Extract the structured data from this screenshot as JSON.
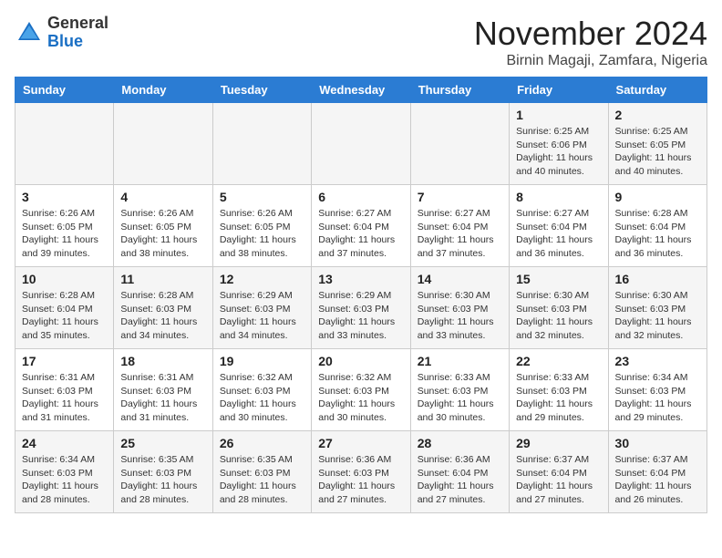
{
  "header": {
    "logo_line1": "General",
    "logo_line2": "Blue",
    "month_title": "November 2024",
    "subtitle": "Birnin Magaji, Zamfara, Nigeria"
  },
  "days_of_week": [
    "Sunday",
    "Monday",
    "Tuesday",
    "Wednesday",
    "Thursday",
    "Friday",
    "Saturday"
  ],
  "weeks": [
    [
      {
        "day": "",
        "info": ""
      },
      {
        "day": "",
        "info": ""
      },
      {
        "day": "",
        "info": ""
      },
      {
        "day": "",
        "info": ""
      },
      {
        "day": "",
        "info": ""
      },
      {
        "day": "1",
        "info": "Sunrise: 6:25 AM\nSunset: 6:06 PM\nDaylight: 11 hours and 40 minutes."
      },
      {
        "day": "2",
        "info": "Sunrise: 6:25 AM\nSunset: 6:05 PM\nDaylight: 11 hours and 40 minutes."
      }
    ],
    [
      {
        "day": "3",
        "info": "Sunrise: 6:26 AM\nSunset: 6:05 PM\nDaylight: 11 hours and 39 minutes."
      },
      {
        "day": "4",
        "info": "Sunrise: 6:26 AM\nSunset: 6:05 PM\nDaylight: 11 hours and 38 minutes."
      },
      {
        "day": "5",
        "info": "Sunrise: 6:26 AM\nSunset: 6:05 PM\nDaylight: 11 hours and 38 minutes."
      },
      {
        "day": "6",
        "info": "Sunrise: 6:27 AM\nSunset: 6:04 PM\nDaylight: 11 hours and 37 minutes."
      },
      {
        "day": "7",
        "info": "Sunrise: 6:27 AM\nSunset: 6:04 PM\nDaylight: 11 hours and 37 minutes."
      },
      {
        "day": "8",
        "info": "Sunrise: 6:27 AM\nSunset: 6:04 PM\nDaylight: 11 hours and 36 minutes."
      },
      {
        "day": "9",
        "info": "Sunrise: 6:28 AM\nSunset: 6:04 PM\nDaylight: 11 hours and 36 minutes."
      }
    ],
    [
      {
        "day": "10",
        "info": "Sunrise: 6:28 AM\nSunset: 6:04 PM\nDaylight: 11 hours and 35 minutes."
      },
      {
        "day": "11",
        "info": "Sunrise: 6:28 AM\nSunset: 6:03 PM\nDaylight: 11 hours and 34 minutes."
      },
      {
        "day": "12",
        "info": "Sunrise: 6:29 AM\nSunset: 6:03 PM\nDaylight: 11 hours and 34 minutes."
      },
      {
        "day": "13",
        "info": "Sunrise: 6:29 AM\nSunset: 6:03 PM\nDaylight: 11 hours and 33 minutes."
      },
      {
        "day": "14",
        "info": "Sunrise: 6:30 AM\nSunset: 6:03 PM\nDaylight: 11 hours and 33 minutes."
      },
      {
        "day": "15",
        "info": "Sunrise: 6:30 AM\nSunset: 6:03 PM\nDaylight: 11 hours and 32 minutes."
      },
      {
        "day": "16",
        "info": "Sunrise: 6:30 AM\nSunset: 6:03 PM\nDaylight: 11 hours and 32 minutes."
      }
    ],
    [
      {
        "day": "17",
        "info": "Sunrise: 6:31 AM\nSunset: 6:03 PM\nDaylight: 11 hours and 31 minutes."
      },
      {
        "day": "18",
        "info": "Sunrise: 6:31 AM\nSunset: 6:03 PM\nDaylight: 11 hours and 31 minutes."
      },
      {
        "day": "19",
        "info": "Sunrise: 6:32 AM\nSunset: 6:03 PM\nDaylight: 11 hours and 30 minutes."
      },
      {
        "day": "20",
        "info": "Sunrise: 6:32 AM\nSunset: 6:03 PM\nDaylight: 11 hours and 30 minutes."
      },
      {
        "day": "21",
        "info": "Sunrise: 6:33 AM\nSunset: 6:03 PM\nDaylight: 11 hours and 30 minutes."
      },
      {
        "day": "22",
        "info": "Sunrise: 6:33 AM\nSunset: 6:03 PM\nDaylight: 11 hours and 29 minutes."
      },
      {
        "day": "23",
        "info": "Sunrise: 6:34 AM\nSunset: 6:03 PM\nDaylight: 11 hours and 29 minutes."
      }
    ],
    [
      {
        "day": "24",
        "info": "Sunrise: 6:34 AM\nSunset: 6:03 PM\nDaylight: 11 hours and 28 minutes."
      },
      {
        "day": "25",
        "info": "Sunrise: 6:35 AM\nSunset: 6:03 PM\nDaylight: 11 hours and 28 minutes."
      },
      {
        "day": "26",
        "info": "Sunrise: 6:35 AM\nSunset: 6:03 PM\nDaylight: 11 hours and 28 minutes."
      },
      {
        "day": "27",
        "info": "Sunrise: 6:36 AM\nSunset: 6:03 PM\nDaylight: 11 hours and 27 minutes."
      },
      {
        "day": "28",
        "info": "Sunrise: 6:36 AM\nSunset: 6:04 PM\nDaylight: 11 hours and 27 minutes."
      },
      {
        "day": "29",
        "info": "Sunrise: 6:37 AM\nSunset: 6:04 PM\nDaylight: 11 hours and 27 minutes."
      },
      {
        "day": "30",
        "info": "Sunrise: 6:37 AM\nSunset: 6:04 PM\nDaylight: 11 hours and 26 minutes."
      }
    ]
  ]
}
